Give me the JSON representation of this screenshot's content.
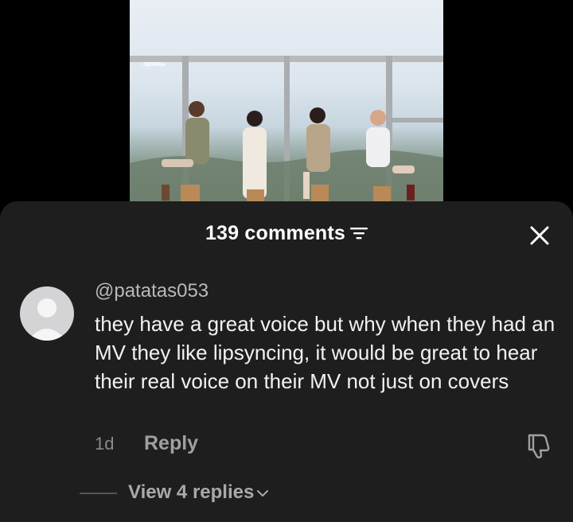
{
  "video": {
    "overlay_logo_text": "NEMIRA",
    "description": "four performers seated on stools singing into microphones"
  },
  "comments_panel": {
    "count_label": "139 comments",
    "sort_icon": "sort-icon",
    "close_icon": "close-icon"
  },
  "comment": {
    "username": "@patatas053",
    "text": "they have a great voice but why when they had an MV they like lipsyncing, it would be great to hear their real voice on their MV not just on covers",
    "age": "1d",
    "reply_label": "Reply",
    "dislike_icon": "thumbs-down-icon",
    "avatar_icon": "default-avatar-icon"
  },
  "replies": {
    "view_label": "View 4 replies",
    "chevron_icon": "chevron-down-icon"
  },
  "colors": {
    "sheet_bg": "#1e1e1e",
    "page_bg": "#000000",
    "muted_text": "#a0a0a0"
  }
}
